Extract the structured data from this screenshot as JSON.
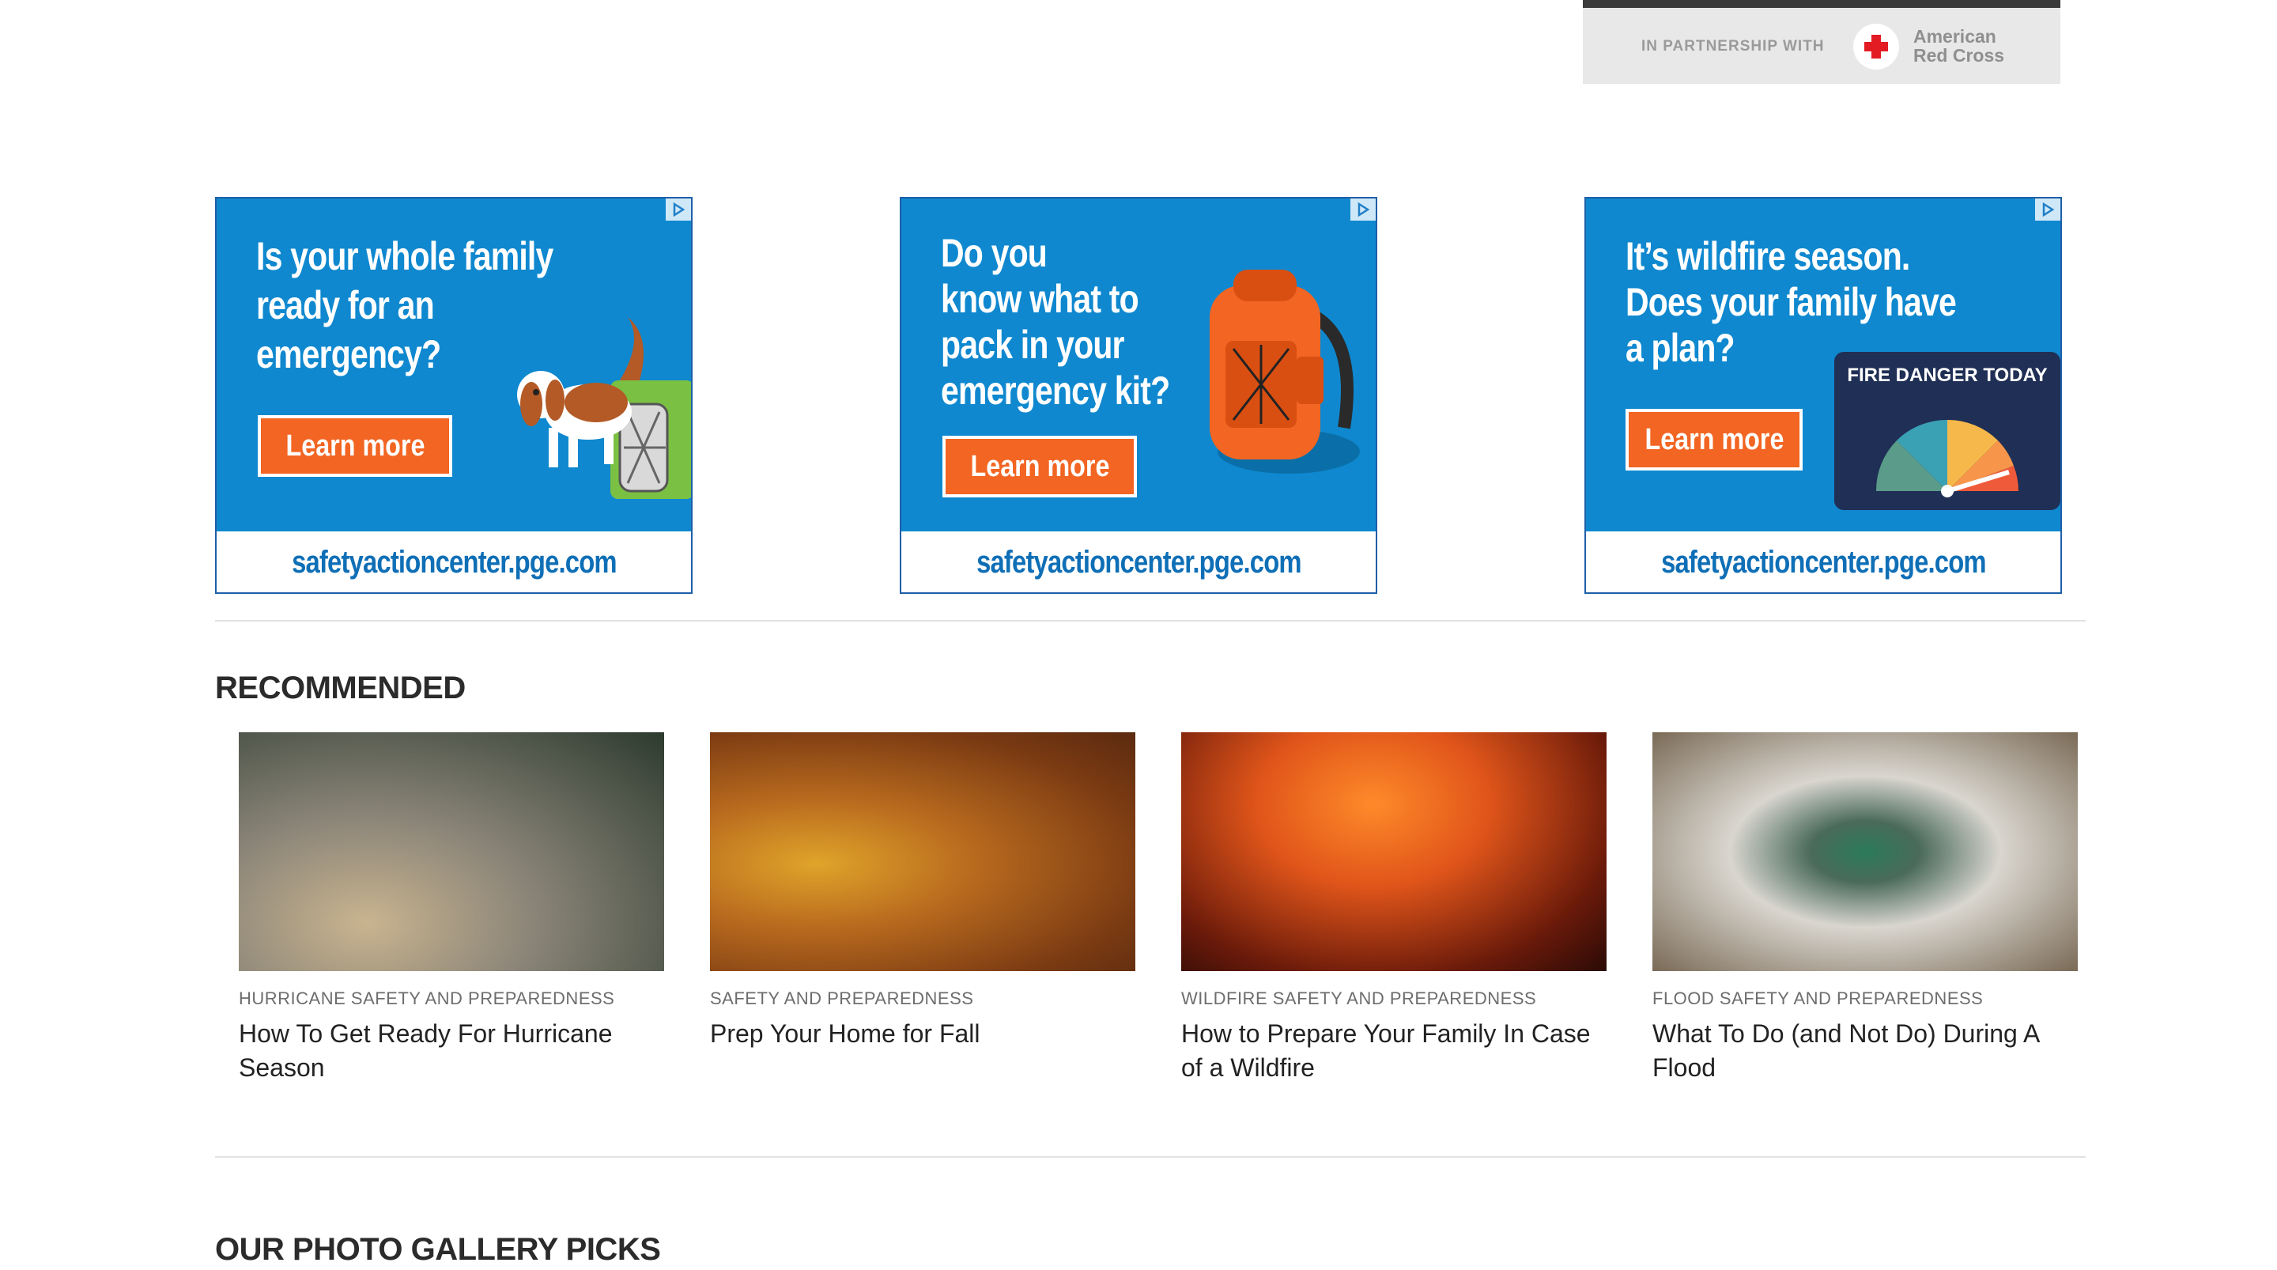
{
  "partnership": {
    "label": "IN PARTNERSHIP WITH",
    "org_name": "American Red Cross",
    "colors": {
      "cross": "#e31b23"
    }
  },
  "ads": [
    {
      "headline": "Is your whole family\nready for an\nemergency?",
      "button": "Learn more",
      "url": "safetyactioncenter.pge.com",
      "illustration": "dog-and-pet-carrier"
    },
    {
      "headline": "Do you\nknow what to\npack in your\nemergency kit?",
      "button": "Learn more",
      "url": "safetyactioncenter.pge.com",
      "illustration": "orange-backpack"
    },
    {
      "headline": "It’s wildfire season.\nDoes your family have\na plan?",
      "button": "Learn more",
      "url": "safetyactioncenter.pge.com",
      "illustration": "fire-danger-gauge",
      "gauge_title": "FIRE DANGER TODAY"
    }
  ],
  "ad_colors": {
    "blue": "#0f88cf",
    "orange": "#f26522",
    "url_text": "#0f6fb6"
  },
  "recommended": {
    "title": "RECOMMENDED",
    "items": [
      {
        "category": "HURRICANE SAFETY AND PREPAREDNESS",
        "title": "How To Get Ready For Hurricane Season"
      },
      {
        "category": "SAFETY AND PREPAREDNESS",
        "title": "Prep Your Home for Fall"
      },
      {
        "category": "WILDFIRE SAFETY AND PREPAREDNESS",
        "title": "How to Prepare Your Family In Case of a Wildfire"
      },
      {
        "category": "FLOOD SAFETY AND PREPAREDNESS",
        "title": "What To Do (and Not Do) During A Flood"
      }
    ]
  },
  "gallery": {
    "title": "OUR PHOTO GALLERY PICKS"
  }
}
